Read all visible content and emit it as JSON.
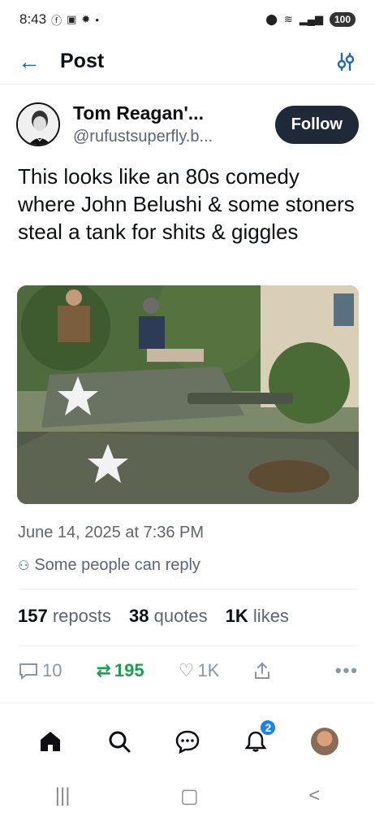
{
  "status_bar": {
    "time": "8:43",
    "battery": "100"
  },
  "header": {
    "title": "Post"
  },
  "post": {
    "author": {
      "display_name": "Tom Reagan'...",
      "handle": "@rufustsuperfly.b..."
    },
    "follow_label": "Follow",
    "text": "This looks like an 80s comedy where John Belushi & some stoners steal a tank for shits & giggles",
    "timestamp": "June 14, 2025 at 7:36 PM",
    "reply_setting": "Some people can reply"
  },
  "stats": {
    "reposts_count": "157",
    "reposts_label": "reposts",
    "quotes_count": "38",
    "quotes_label": "quotes",
    "likes_count": "1K",
    "likes_label": "likes"
  },
  "actions": {
    "replies": "10",
    "reposts": "195",
    "likes": "1K"
  },
  "nav": {
    "notifications_badge": "2"
  },
  "colors": {
    "accent": "#1d67b5",
    "repost_green": "#16a34a",
    "follow_bg": "#1f2937",
    "badge_blue": "#1d82ea"
  }
}
